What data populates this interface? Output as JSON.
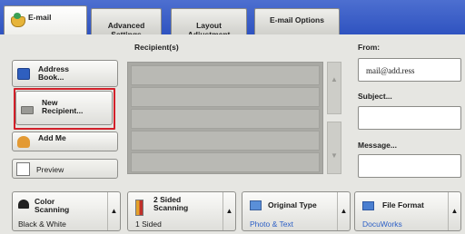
{
  "tabs": [
    {
      "label": "E-mail"
    },
    {
      "label": "Advanced\nSettings"
    },
    {
      "label": "Layout\nAdjustment"
    },
    {
      "label": "E-mail Options"
    }
  ],
  "left_buttons": {
    "address_book": "Address\nBook...",
    "new_recipient": "New\nRecipient...",
    "add_me": "Add Me",
    "preview": "Preview"
  },
  "recipients": {
    "header": "Recipient(s)",
    "scroll_up": "▲",
    "scroll_down": "▼"
  },
  "fields": {
    "from_label": "From:",
    "from_value": "mail@add.ress",
    "subject_label": "Subject...",
    "subject_value": "",
    "message_label": "Message...",
    "message_value": ""
  },
  "bottom": [
    {
      "title": "Color\nScanning",
      "value": "Black & White"
    },
    {
      "title": "2 Sided\nScanning",
      "value": "1 Sided"
    },
    {
      "title": "Original Type",
      "value": "Photo & Text"
    },
    {
      "title": "File Format",
      "value": "DocuWorks"
    }
  ],
  "arrow_glyph": "▲",
  "colors": {
    "header_blue": "#3a5ec8",
    "highlight_red": "#d2202a",
    "value_blue": "#2c5fc6"
  }
}
